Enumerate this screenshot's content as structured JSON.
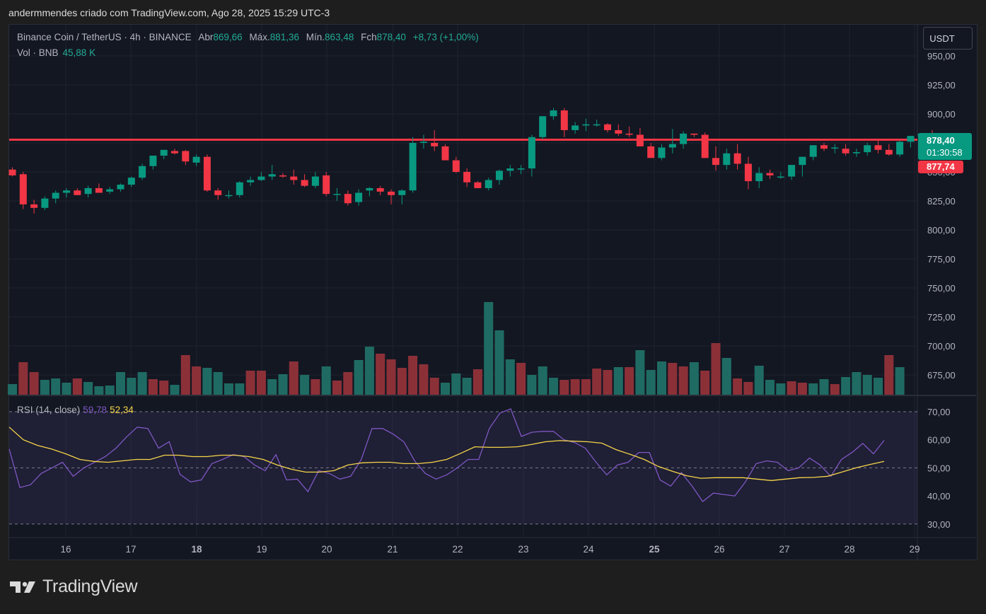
{
  "header": {
    "text": "andermmendes criado com TradingView.com, Ago 28, 2025 15:29 UTC-3"
  },
  "legend": {
    "symbol": "Binance Coin / TetherUS · 4h · BINANCE",
    "open_label": "Abr",
    "open_value": "869,66",
    "high_label": "Máx.",
    "high_value": "881,36",
    "low_label": "Mín.",
    "low_value": "863,48",
    "close_label": "Fch",
    "close_value": "878,40",
    "change": "+8,73 (+1,00%)"
  },
  "volume_legend": {
    "label": "Vol · BNB",
    "value": "45,88 K"
  },
  "rsi_legend": {
    "label": "RSI (14, close)",
    "value1": "59,78",
    "value2": "52,34"
  },
  "currency_button": "USDT",
  "price_tag": {
    "price": "878,40",
    "countdown": "01:30:58"
  },
  "line_tag": {
    "price": "877,74"
  },
  "logo": {
    "text": "TradingView"
  },
  "colors": {
    "up": "#089981",
    "down": "#f23645",
    "rsi": "#7e57c2",
    "rsi_ma": "#f5d44a",
    "hline": "#f23645"
  },
  "chart_data": [
    {
      "type": "candlestick",
      "symbol": "BNB/USDT",
      "timeframe": "4h",
      "ylim": [
        665,
        960
      ],
      "y_ticks": [
        "675,00",
        "700,00",
        "725,00",
        "750,00",
        "775,00",
        "800,00",
        "825,00",
        "850,00",
        "875,00",
        "900,00",
        "925,00",
        "950,00"
      ],
      "y_tick_values": [
        675,
        700,
        725,
        750,
        775,
        800,
        825,
        850,
        875,
        900,
        925,
        950
      ],
      "x_labels": [
        "16",
        "17",
        "18",
        "19",
        "20",
        "21",
        "22",
        "23",
        "24",
        "25",
        "26",
        "27",
        "28",
        "29"
      ],
      "x_label_bold": [
        "18",
        "25"
      ],
      "horizontal_line": 877.74,
      "candles": [
        [
          852,
          854,
          846,
          847
        ],
        [
          848,
          850,
          818,
          822
        ],
        [
          822,
          826,
          814,
          819
        ],
        [
          819,
          829,
          817,
          827
        ],
        [
          827,
          834,
          823,
          832
        ],
        [
          832,
          836,
          828,
          834
        ],
        [
          834,
          836,
          830,
          830
        ],
        [
          831,
          838,
          828,
          836
        ],
        [
          836,
          840,
          832,
          832
        ],
        [
          833,
          837,
          831,
          835
        ],
        [
          835,
          840,
          833,
          839
        ],
        [
          839,
          846,
          837,
          845
        ],
        [
          845,
          857,
          843,
          855
        ],
        [
          855,
          864,
          852,
          864
        ],
        [
          864,
          868,
          861,
          869
        ],
        [
          868,
          870,
          865,
          866
        ],
        [
          868,
          869,
          856,
          859
        ],
        [
          858,
          865,
          855,
          863
        ],
        [
          863,
          865,
          833,
          834
        ],
        [
          834,
          836,
          826,
          830
        ],
        [
          830,
          834,
          827,
          830
        ],
        [
          830,
          842,
          828,
          841
        ],
        [
          841,
          846,
          838,
          843
        ],
        [
          843,
          850,
          842,
          846
        ],
        [
          846,
          856,
          843,
          848
        ],
        [
          847,
          849,
          845,
          846
        ],
        [
          846,
          852,
          839,
          843
        ],
        [
          843,
          848,
          837,
          838
        ],
        [
          838,
          850,
          836,
          846
        ],
        [
          847,
          850,
          829,
          831
        ],
        [
          831,
          836,
          825,
          831
        ],
        [
          831,
          834,
          821,
          823
        ],
        [
          824,
          835,
          821,
          832
        ],
        [
          834,
          837,
          829,
          836
        ],
        [
          836,
          838,
          830,
          833
        ],
        [
          833,
          835,
          822,
          830
        ],
        [
          830,
          835,
          822,
          834
        ],
        [
          834,
          880,
          832,
          875
        ],
        [
          875,
          882,
          870,
          876
        ],
        [
          875,
          886,
          868,
          872
        ],
        [
          872,
          874,
          861,
          860
        ],
        [
          860,
          863,
          849,
          850
        ],
        [
          850,
          853,
          837,
          841
        ],
        [
          841,
          842,
          836,
          836
        ],
        [
          836,
          845,
          834,
          843
        ],
        [
          843,
          852,
          839,
          851
        ],
        [
          851,
          856,
          846,
          853
        ],
        [
          852,
          856,
          848,
          853
        ],
        [
          853,
          882,
          846,
          880
        ],
        [
          880,
          898,
          878,
          898
        ],
        [
          898,
          905,
          895,
          903
        ],
        [
          903,
          905,
          880,
          886
        ],
        [
          886,
          893,
          883,
          890
        ],
        [
          890,
          896,
          885,
          891
        ],
        [
          891,
          895,
          889,
          891
        ],
        [
          891,
          892,
          884,
          886
        ],
        [
          886,
          891,
          881,
          883
        ],
        [
          883,
          889,
          880,
          882
        ],
        [
          882,
          888,
          872,
          872
        ],
        [
          872,
          875,
          863,
          862
        ],
        [
          862,
          874,
          860,
          871
        ],
        [
          871,
          887,
          866,
          874
        ],
        [
          874,
          885,
          870,
          883
        ],
        [
          883,
          883,
          880,
          882
        ],
        [
          882,
          884,
          862,
          862
        ],
        [
          862,
          872,
          851,
          856
        ],
        [
          856,
          870,
          852,
          866
        ],
        [
          866,
          874,
          852,
          857
        ],
        [
          857,
          863,
          835,
          842
        ],
        [
          842,
          854,
          836,
          849
        ],
        [
          849,
          852,
          844,
          847
        ],
        [
          846,
          850,
          844,
          846
        ],
        [
          846,
          855,
          843,
          856
        ],
        [
          856,
          863,
          846,
          863
        ],
        [
          863,
          872,
          860,
          873
        ],
        [
          873,
          875,
          868,
          870
        ],
        [
          871,
          874,
          866,
          871
        ],
        [
          870,
          874,
          864,
          866
        ],
        [
          866,
          870,
          863,
          867
        ],
        [
          867,
          875,
          864,
          873
        ],
        [
          873,
          877,
          866,
          869
        ],
        [
          869,
          874,
          864,
          865
        ],
        [
          865,
          877,
          863,
          876
        ],
        [
          876,
          879,
          871,
          881
        ],
        [
          881,
          882,
          874,
          883
        ],
        [
          883,
          886,
          876,
          878
        ],
        [
          878,
          881,
          869,
          878
        ]
      ],
      "volume": [
        [
          15,
          "up"
        ],
        [
          46,
          "down"
        ],
        [
          32,
          "down"
        ],
        [
          21,
          "up"
        ],
        [
          23,
          "up"
        ],
        [
          17,
          "up"
        ],
        [
          23,
          "down"
        ],
        [
          18,
          "up"
        ],
        [
          12,
          "up"
        ],
        [
          13,
          "up"
        ],
        [
          32,
          "up"
        ],
        [
          24,
          "up"
        ],
        [
          32,
          "up"
        ],
        [
          22,
          "down"
        ],
        [
          20,
          "down"
        ],
        [
          14,
          "up"
        ],
        [
          56,
          "down"
        ],
        [
          40,
          "down"
        ],
        [
          38,
          "up"
        ],
        [
          32,
          "up"
        ],
        [
          16,
          "up"
        ],
        [
          16,
          "up"
        ],
        [
          34,
          "down"
        ],
        [
          34,
          "down"
        ],
        [
          22,
          "up"
        ],
        [
          29,
          "up"
        ],
        [
          47,
          "down"
        ],
        [
          28,
          "up"
        ],
        [
          22,
          "down"
        ],
        [
          40,
          "up"
        ],
        [
          20,
          "down"
        ],
        [
          32,
          "down"
        ],
        [
          49,
          "up"
        ],
        [
          68,
          "up"
        ],
        [
          58,
          "down"
        ],
        [
          50,
          "down"
        ],
        [
          38,
          "down"
        ],
        [
          55,
          "down"
        ],
        [
          43,
          "down"
        ],
        [
          24,
          "down"
        ],
        [
          17,
          "up"
        ],
        [
          30,
          "up"
        ],
        [
          24,
          "up"
        ],
        [
          36,
          "down"
        ],
        [
          131,
          "up"
        ],
        [
          91,
          "up"
        ],
        [
          50,
          "up"
        ],
        [
          45,
          "down"
        ],
        [
          28,
          "up"
        ],
        [
          40,
          "up"
        ],
        [
          24,
          "up"
        ],
        [
          21,
          "down"
        ],
        [
          22,
          "down"
        ],
        [
          22,
          "down"
        ],
        [
          37,
          "down"
        ],
        [
          35,
          "down"
        ],
        [
          39,
          "up"
        ],
        [
          39,
          "down"
        ],
        [
          63,
          "up"
        ],
        [
          35,
          "up"
        ],
        [
          47,
          "up"
        ],
        [
          45,
          "down"
        ],
        [
          40,
          "down"
        ],
        [
          46,
          "up"
        ],
        [
          34,
          "down"
        ],
        [
          73,
          "down"
        ],
        [
          52,
          "up"
        ],
        [
          23,
          "down"
        ],
        [
          18,
          "down"
        ],
        [
          41,
          "up"
        ],
        [
          21,
          "up"
        ],
        [
          16,
          "up"
        ],
        [
          19,
          "down"
        ],
        [
          17,
          "down"
        ],
        [
          16,
          "up"
        ],
        [
          22,
          "up"
        ],
        [
          15,
          "down"
        ],
        [
          25,
          "up"
        ],
        [
          32,
          "up"
        ],
        [
          28,
          "up"
        ],
        [
          24,
          "up"
        ],
        [
          56,
          "down"
        ],
        [
          39,
          "up"
        ]
      ],
      "volume_value": "45,88 K"
    },
    {
      "type": "line",
      "title": "RSI (14, close)",
      "ylim": [
        27,
        73
      ],
      "y_ticks": [
        "30,00",
        "40,00",
        "50,00",
        "60,00",
        "70,00"
      ],
      "y_tick_values": [
        30,
        40,
        50,
        60,
        70
      ],
      "bands": [
        30,
        50,
        70
      ],
      "series": [
        {
          "name": "RSI",
          "values": [
            56.7,
            43,
            44,
            48,
            50,
            52,
            47,
            50,
            52,
            54,
            57,
            61,
            64.5,
            64,
            57,
            59.3,
            47.7,
            45,
            45.7,
            51.5,
            53,
            54.7,
            54,
            51,
            49,
            54.7,
            45.7,
            46,
            41.5,
            49,
            48,
            46,
            47,
            53,
            64,
            64,
            62,
            59.2,
            52.5,
            48,
            46,
            47.5,
            50,
            53,
            53,
            64,
            69.5,
            71,
            61.2,
            62.7,
            63,
            63,
            60,
            59,
            57,
            52,
            47.5,
            51,
            52,
            55.5,
            55.5,
            45.7,
            43.5,
            48.3,
            43.5,
            38,
            41,
            40.5,
            40,
            45,
            51.5,
            52.5,
            52,
            49,
            50,
            53.5,
            51,
            47,
            53,
            55.5,
            58.7,
            55,
            59.8
          ]
        },
        {
          "name": "RSI-based MA",
          "values": [
            64.5,
            60,
            58,
            56.7,
            55,
            53,
            52.3,
            52,
            52.5,
            53,
            53,
            54.5,
            54.5,
            54,
            54,
            54.5,
            54.5,
            54,
            53,
            51,
            49.5,
            48.5,
            48.5,
            49,
            51,
            51.8,
            52,
            52,
            51.5,
            51.5,
            52,
            53,
            55.2,
            57.5,
            57.3,
            57.3,
            57.5,
            58.3,
            59.3,
            59.7,
            59.5,
            59.3,
            58.8,
            56.5,
            54.8,
            53,
            50.5,
            48.8,
            47.2,
            46.3,
            46.5,
            46.5,
            46.5,
            46,
            45.5,
            46,
            46.5,
            46.6,
            47,
            48.5,
            50,
            51.2,
            52.3
          ]
        }
      ],
      "value1": "59,78",
      "value2": "52,34"
    }
  ]
}
